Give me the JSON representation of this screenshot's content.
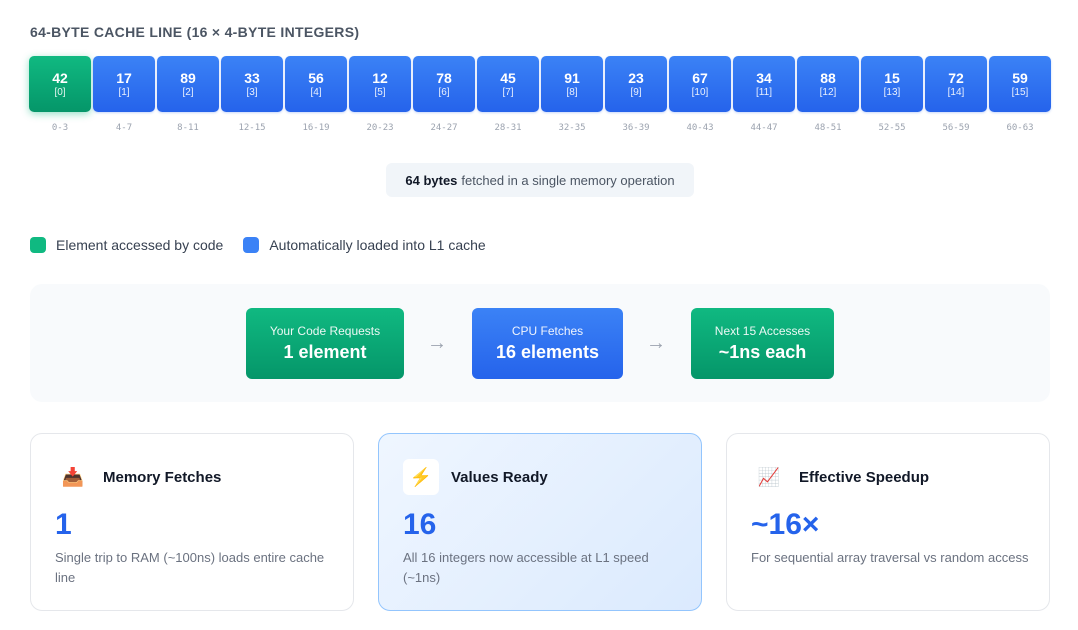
{
  "title": "64-BYTE CACHE LINE (16 × 4-BYTE INTEGERS)",
  "colors": {
    "accessed": "#10b981",
    "loaded": "#3b82f6",
    "value_text": "#2563eb"
  },
  "cells": [
    {
      "value": "42",
      "index": "[0]",
      "range": "0-3",
      "accessed": true
    },
    {
      "value": "17",
      "index": "[1]",
      "range": "4-7",
      "accessed": false
    },
    {
      "value": "89",
      "index": "[2]",
      "range": "8-11",
      "accessed": false
    },
    {
      "value": "33",
      "index": "[3]",
      "range": "12-15",
      "accessed": false
    },
    {
      "value": "56",
      "index": "[4]",
      "range": "16-19",
      "accessed": false
    },
    {
      "value": "12",
      "index": "[5]",
      "range": "20-23",
      "accessed": false
    },
    {
      "value": "78",
      "index": "[6]",
      "range": "24-27",
      "accessed": false
    },
    {
      "value": "45",
      "index": "[7]",
      "range": "28-31",
      "accessed": false
    },
    {
      "value": "91",
      "index": "[8]",
      "range": "32-35",
      "accessed": false
    },
    {
      "value": "23",
      "index": "[9]",
      "range": "36-39",
      "accessed": false
    },
    {
      "value": "67",
      "index": "[10]",
      "range": "40-43",
      "accessed": false
    },
    {
      "value": "34",
      "index": "[11]",
      "range": "44-47",
      "accessed": false
    },
    {
      "value": "88",
      "index": "[12]",
      "range": "48-51",
      "accessed": false
    },
    {
      "value": "15",
      "index": "[13]",
      "range": "52-55",
      "accessed": false
    },
    {
      "value": "72",
      "index": "[14]",
      "range": "56-59",
      "accessed": false
    },
    {
      "value": "59",
      "index": "[15]",
      "range": "60-63",
      "accessed": false
    }
  ],
  "fetch_note": {
    "bold": "64 bytes",
    "rest": "fetched in a single memory operation"
  },
  "legend": {
    "accessed": "Element accessed by code",
    "loaded": "Automatically loaded into L1 cache"
  },
  "flow": {
    "arrow": "→",
    "steps": [
      {
        "label": "Your Code Requests",
        "value": "1 element",
        "color": "green"
      },
      {
        "label": "CPU Fetches",
        "value": "16 elements",
        "color": "blue"
      },
      {
        "label": "Next 15 Accesses",
        "value": "~1ns each",
        "color": "green"
      }
    ]
  },
  "cards": [
    {
      "icon": "inbox-tray-icon",
      "glyph": "📥",
      "title": "Memory Fetches",
      "value": "1",
      "desc": "Single trip to RAM (~100ns) loads entire cache line"
    },
    {
      "icon": "lightning-icon",
      "glyph": "⚡",
      "title": "Values Ready",
      "value": "16",
      "desc": "All 16 integers now accessible at L1 speed (~1ns)"
    },
    {
      "icon": "chart-increasing-icon",
      "glyph": "📈",
      "title": "Effective Speedup",
      "value": "~16×",
      "desc": "For sequential array traversal vs random access"
    }
  ]
}
